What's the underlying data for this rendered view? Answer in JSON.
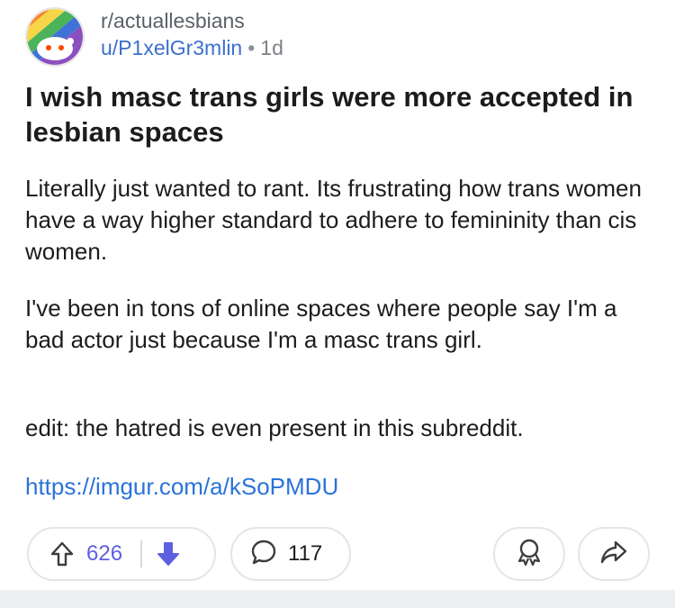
{
  "post": {
    "subreddit": "r/actuallesbians",
    "author": "u/P1xelGr3mlin",
    "separator": "•",
    "age": "1d",
    "title": "I wish masc trans girls were more accepted in lesbian spaces",
    "paragraphs": [
      "Literally just wanted to rant. Its frustrating how trans women have a way higher standard to adhere to femininity than cis women.",
      "I've been in tons of online spaces where people say I'm a bad actor just because I'm a masc trans girl.",
      "edit: the hatred is even present in this subreddit."
    ],
    "link": "https://imgur.com/a/kSoPMDU"
  },
  "actions": {
    "votes": "626",
    "comments": "117",
    "upvote_icon": "upvote-arrow-icon",
    "downvote_icon": "downvote-arrow-icon",
    "comment_icon": "comment-bubble-icon",
    "award_icon": "award-icon",
    "share_icon": "share-arrow-icon"
  },
  "colors": {
    "vote_accent": "#5d5fe0",
    "link": "#2a73d9",
    "username": "#3b6fcf"
  }
}
